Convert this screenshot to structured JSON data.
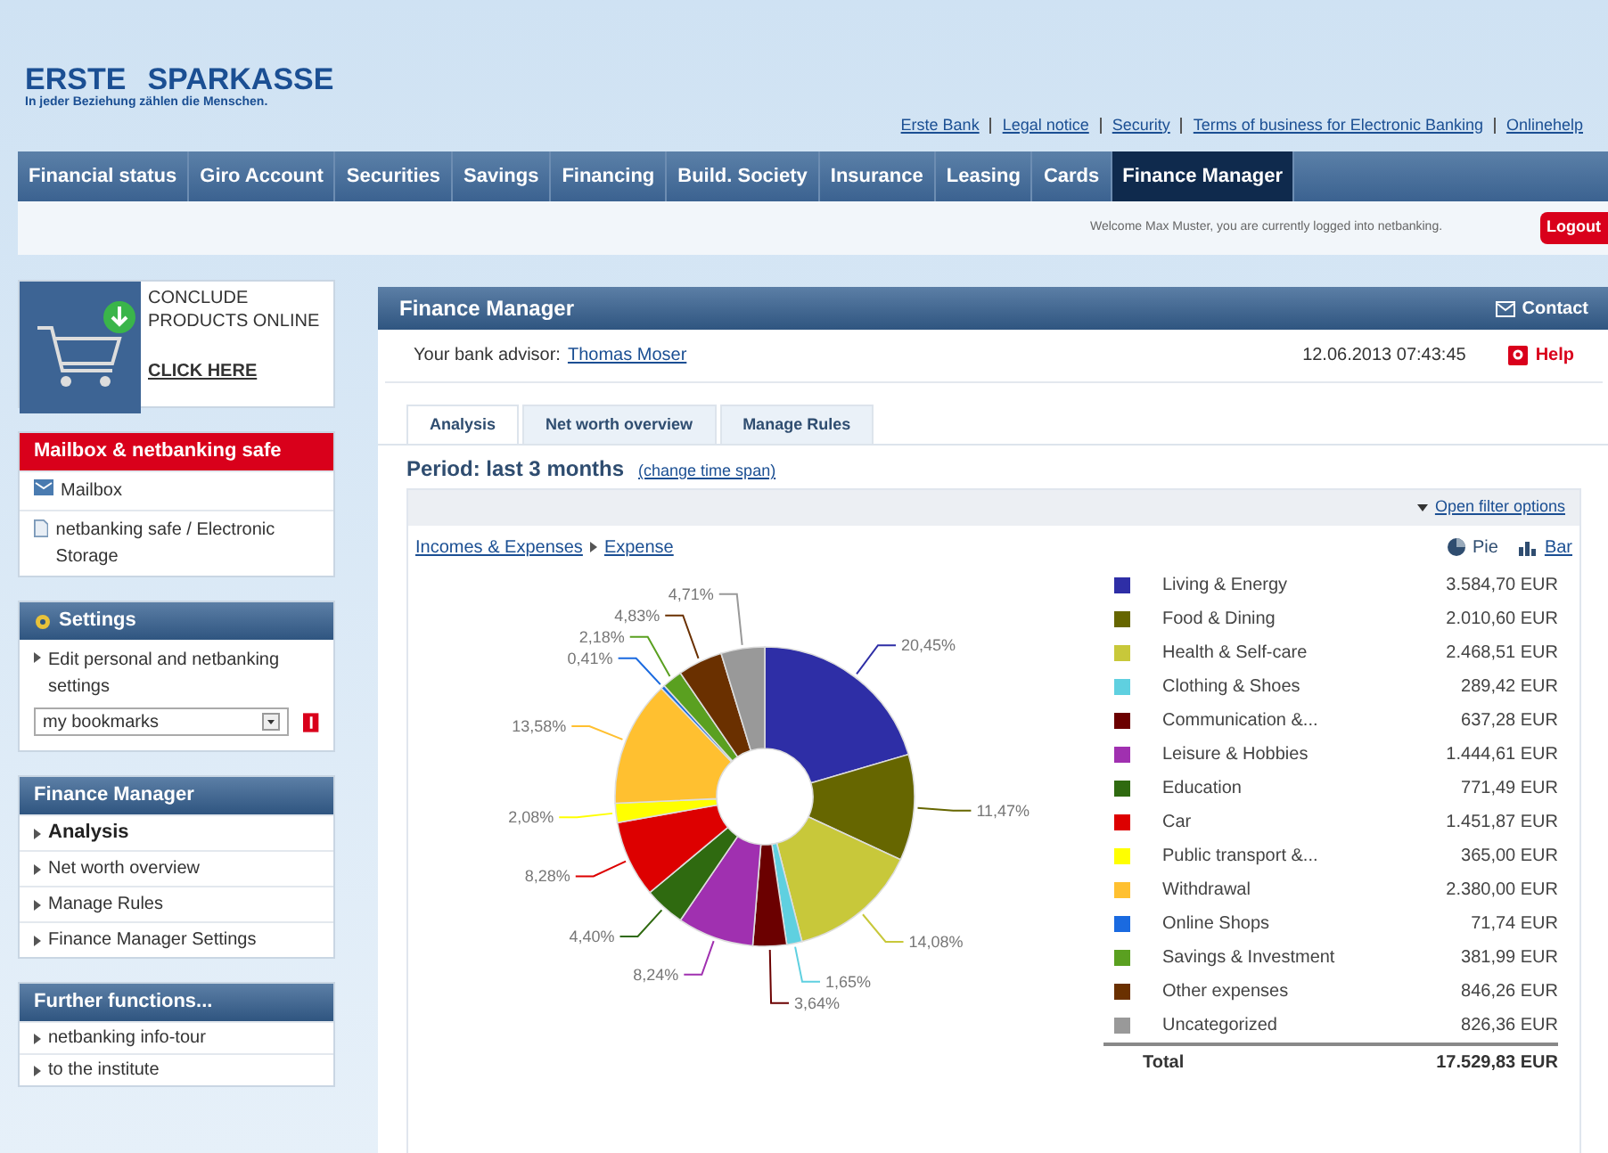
{
  "logo": {
    "brand_1": "ERSTE",
    "brand_2": "SPARKASSE",
    "slogan": "In jeder Beziehung zählen die Menschen."
  },
  "top_links": [
    "Erste Bank",
    "Legal notice",
    "Security",
    "Terms of business for Electronic Banking",
    "Onlinehelp"
  ],
  "nav": [
    {
      "label": "Financial status",
      "selected": false
    },
    {
      "label": "Giro Account",
      "selected": false
    },
    {
      "label": "Securities",
      "selected": false
    },
    {
      "label": "Savings",
      "selected": false
    },
    {
      "label": "Financing",
      "selected": false
    },
    {
      "label": "Build. Society",
      "selected": false
    },
    {
      "label": "Insurance",
      "selected": false
    },
    {
      "label": "Leasing",
      "selected": false
    },
    {
      "label": "Cards",
      "selected": false
    },
    {
      "label": "Finance Manager",
      "selected": true
    }
  ],
  "welcome": "Welcome Max Muster, you are currently logged into netbanking.",
  "logout": "Logout",
  "promo": {
    "title": "CONCLUDE PRODUCTS ONLINE",
    "link": "CLICK HERE"
  },
  "mailbox_panel": {
    "title": "Mailbox & netbanking safe",
    "items": [
      {
        "kind": "mail",
        "label": "Mailbox"
      },
      {
        "kind": "document",
        "label": "netbanking safe / Electronic Storage"
      }
    ]
  },
  "settings_panel": {
    "title": "Settings",
    "link": "Edit personal and netbanking settings",
    "bookmarks": "my bookmarks"
  },
  "fm_panel": {
    "title": "Finance Manager",
    "items": [
      {
        "label": "Analysis",
        "selected": true
      },
      {
        "label": "Net worth overview",
        "selected": false
      },
      {
        "label": "Manage Rules",
        "selected": false
      },
      {
        "label": "Finance Manager Settings",
        "selected": false
      }
    ]
  },
  "further_panel": {
    "title": "Further functions...",
    "items": [
      "netbanking info-tour",
      "to the institute"
    ]
  },
  "main": {
    "title": "Finance Manager",
    "contact": "Contact",
    "advisor_label": "Your bank advisor:",
    "advisor": "Thomas Moser",
    "datetime": "12.06.2013 07:43:45",
    "help": "Help",
    "tabs": [
      {
        "label": "Analysis",
        "selected": true
      },
      {
        "label": "Net worth overview",
        "selected": false
      },
      {
        "label": "Manage Rules",
        "selected": false
      }
    ],
    "period": "Period: last 3 months",
    "change": "(change time span)",
    "filter": "Open filter options",
    "breadcrumb": [
      "Incomes & Expenses",
      "Expense"
    ],
    "view_pie": "Pie",
    "view_bar": "Bar",
    "chart_data": {
      "type": "donut",
      "categories": [
        "Living & Energy",
        "Food & Dining",
        "Health & Self-care",
        "Clothing & Shoes",
        "Communication &...",
        "Leisure & Hobbies",
        "Education",
        "Car",
        "Public transport &...",
        "Withdrawal",
        "Online Shops",
        "Savings & Investment",
        "Other expenses",
        "Uncategorized"
      ],
      "series": [
        {
          "values": [
            20.45,
            11.47,
            14.08,
            1.65,
            3.64,
            8.24,
            4.4,
            8.28,
            2.08,
            13.58,
            0.41,
            2.18,
            4.83,
            4.71
          ]
        }
      ],
      "value_labels": [
        "20,45%",
        "11,47%",
        "14,08%",
        "1,65%",
        "3,64%",
        "8,24%",
        "4,40%",
        "8,28%",
        "2,08%",
        "13,58%",
        "0,41%",
        "2,18%",
        "4,83%",
        "4,71%"
      ]
    },
    "legend": [
      {
        "amount": "3.584,70 EUR",
        "color": "#2e2ea6"
      },
      {
        "amount": "2.010,60 EUR",
        "color": "#666600"
      },
      {
        "amount": "2.468,51 EUR",
        "color": "#c8c83a"
      },
      {
        "amount": "289,42 EUR",
        "color": "#5fd0e0"
      },
      {
        "amount": "637,28 EUR",
        "color": "#6b0000"
      },
      {
        "amount": "1.444,61 EUR",
        "color": "#a030b0"
      },
      {
        "amount": "771,49 EUR",
        "color": "#2f6a10"
      },
      {
        "amount": "1.451,87 EUR",
        "color": "#dd0000"
      },
      {
        "amount": "365,00 EUR",
        "color": "#ffff00"
      },
      {
        "amount": "2.380,00 EUR",
        "color": "#ffc030"
      },
      {
        "amount": "71,74 EUR",
        "color": "#1a6ae0"
      },
      {
        "amount": "381,99 EUR",
        "color": "#5aa020"
      },
      {
        "amount": "846,26 EUR",
        "color": "#6a3000"
      },
      {
        "amount": "826,36 EUR",
        "color": "#999999"
      }
    ],
    "total_label": "Total",
    "total": "17.529,83 EUR"
  }
}
